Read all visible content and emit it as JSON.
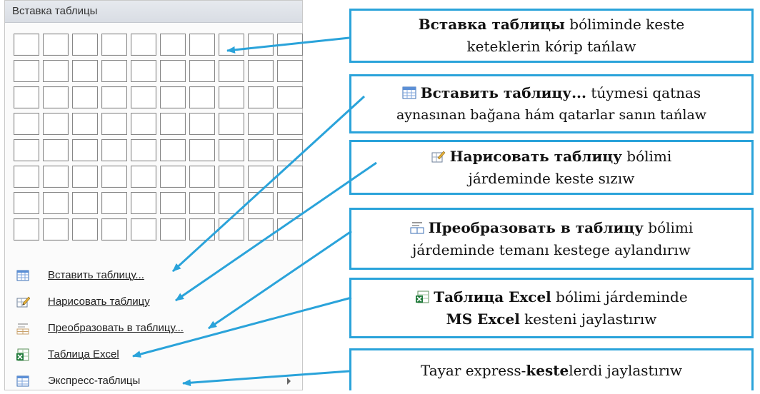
{
  "menu": {
    "header": "Вставка таблицы",
    "items": [
      {
        "label": "Вставить таблицу...",
        "icon": "insert-table-icon"
      },
      {
        "label": "Нарисовать таблицу",
        "icon": "draw-table-icon"
      },
      {
        "label": "Преобразовать в таблицу...",
        "icon": "convert-to-table-icon"
      },
      {
        "label": "Таблица Excel",
        "icon": "excel-table-icon"
      },
      {
        "label": "Экспресс-таблицы",
        "icon": "quick-tables-icon"
      }
    ]
  },
  "callouts": [
    {
      "line1_bold": "Вставка таблицы",
      "line1_rest": " bólіminde keste",
      "line2": "keteklerin kórip tańlaw"
    },
    {
      "line1_bold": "Вставить таблицу...",
      "line1_rest": " túymesi qatnas",
      "line2": "aynasınan bağana hám qatarlar sanın tańlaw"
    },
    {
      "line1_bold": "Нарисовать таблицу",
      "line1_rest": " bólimi",
      "line2": "járdeminde keste sızıw"
    },
    {
      "line1_bold": "Преобразовать в таблицу",
      "line1_rest": " bólimi",
      "line2": "járdeminde temanı kestege aylandırıw"
    },
    {
      "line1_bold": "Таблица Excel",
      "line1_rest": " bólimi járdeminde",
      "line2_bold": "MS Excel",
      "line2": " kesteni jaylastırıw"
    },
    {
      "line1_pre": "Tayar express-",
      "line1_bold": "keste",
      "line1_rest": "lerdi jaylastırıw"
    }
  ],
  "colors": {
    "accent": "#2aa3da"
  }
}
